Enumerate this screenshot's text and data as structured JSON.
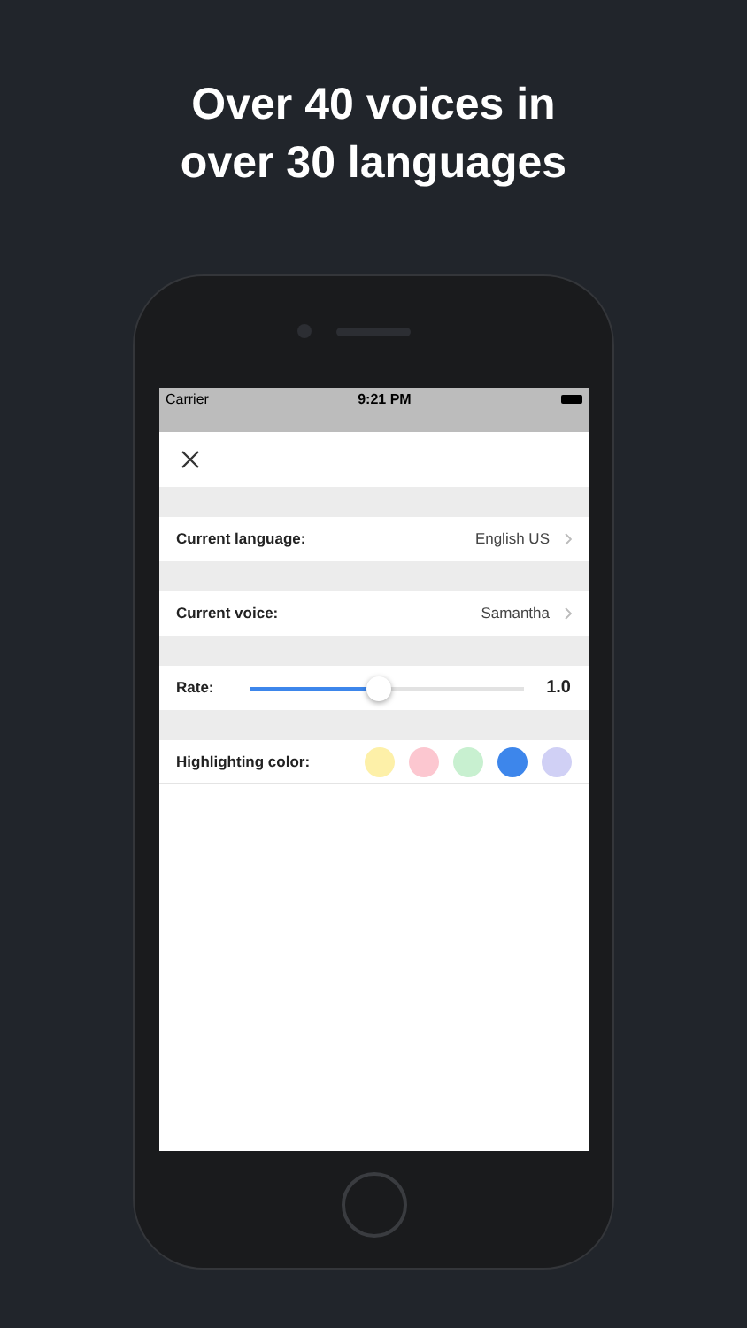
{
  "headline": "Over 40 voices in over 30 languages",
  "status_bar": {
    "carrier": "Carrier",
    "time": "9:21 PM"
  },
  "settings": [
    {
      "kind": "link",
      "label": "Current language:",
      "value": "English US"
    },
    {
      "kind": "link",
      "label": "Current voice:",
      "value": "Samantha"
    },
    {
      "kind": "slider",
      "label": "Rate:",
      "level": 0.47,
      "reading": "1.0"
    },
    {
      "kind": "colors",
      "label": "Highlighting color:",
      "colors": [
        {
          "color": "#fdf0a8"
        },
        {
          "color": "#fcc7d0"
        },
        {
          "color": "#c8f0d0"
        },
        {
          "color": "#3d86eb"
        },
        {
          "color": "#d0d0f5"
        }
      ]
    }
  ]
}
